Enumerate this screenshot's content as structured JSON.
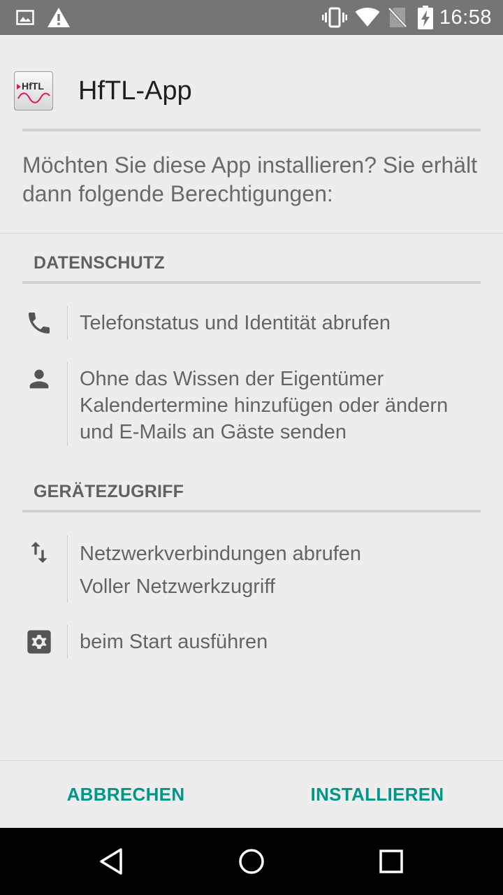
{
  "status_bar": {
    "time": "16:58",
    "icons": [
      "image-notification-icon",
      "warning-icon",
      "vibrate-icon",
      "wifi-icon",
      "no-sim-icon",
      "battery-charging-icon"
    ]
  },
  "app": {
    "name": "HfTL-App",
    "icon_text": "HfTL"
  },
  "question": "Möchten Sie diese App installieren? Sie erhält dann folgende Berechtigungen:",
  "sections": [
    {
      "title": "DATENSCHUTZ",
      "permissions": [
        {
          "icon": "phone-icon",
          "lines": [
            "Telefonstatus und Identität abrufen"
          ]
        },
        {
          "icon": "person-icon",
          "lines": [
            "Ohne das Wissen der Eigentümer",
            "Kalendertermine hinzufügen oder ändern",
            "und E-Mails an Gäste senden"
          ]
        }
      ]
    },
    {
      "title": "GERÄTEZUGRIFF",
      "permissions": [
        {
          "icon": "network-arrows-icon",
          "lines": [
            "Netzwerkverbindungen abrufen",
            "Voller Netzwerkzugriff"
          ]
        },
        {
          "icon": "settings-gear-icon",
          "lines": [
            "beim Start ausführen"
          ]
        }
      ]
    }
  ],
  "buttons": {
    "cancel": "ABBRECHEN",
    "install": "INSTALLIEREN"
  },
  "colors": {
    "accent": "#009688",
    "status_bar": "#757575",
    "background": "#ededed"
  },
  "nav_bar": {
    "icons": [
      "back-icon",
      "home-icon",
      "recents-icon"
    ]
  }
}
